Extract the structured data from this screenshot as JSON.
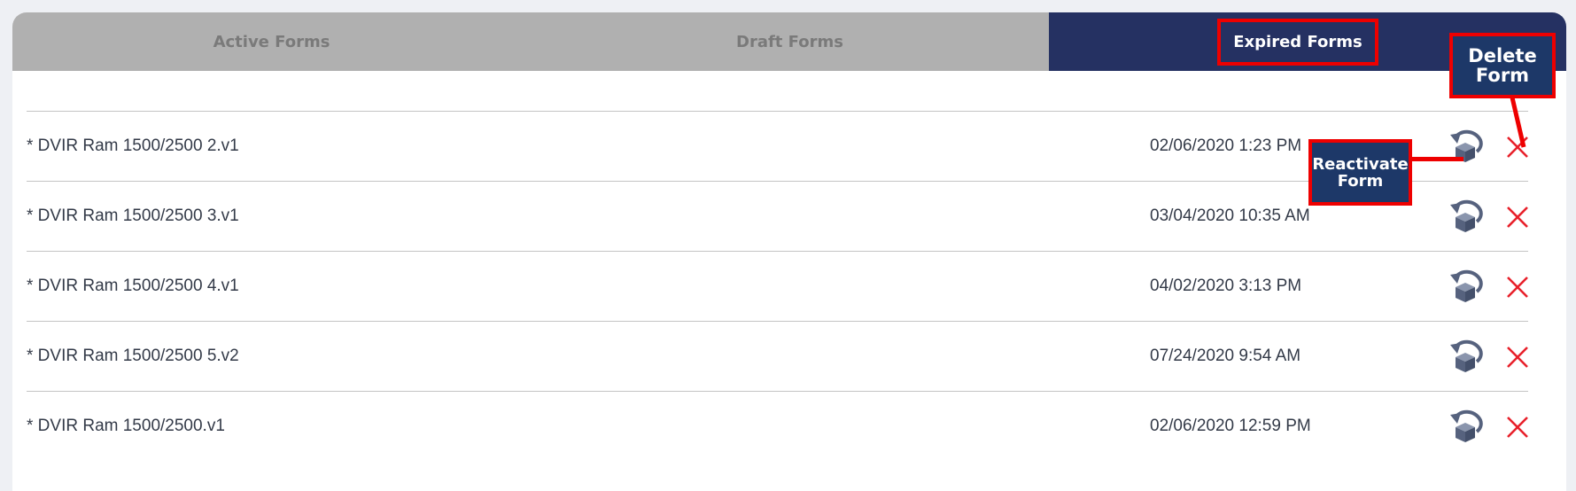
{
  "tabs": [
    {
      "label": "Active Forms",
      "state": "inactive"
    },
    {
      "label": "Draft Forms",
      "state": "inactive"
    },
    {
      "label": "Expired Forms",
      "state": "active"
    }
  ],
  "forms": [
    {
      "name": "* DVIR Ram 1500/2500 2.v1",
      "date": "02/06/2020 1:23 PM"
    },
    {
      "name": "* DVIR Ram 1500/2500 3.v1",
      "date": "03/04/2020 10:35 AM"
    },
    {
      "name": "* DVIR Ram 1500/2500 4.v1",
      "date": "04/02/2020 3:13 PM"
    },
    {
      "name": "* DVIR Ram 1500/2500 5.v2",
      "date": "07/24/2020 9:54 AM"
    },
    {
      "name": "* DVIR Ram 1500/2500.v1",
      "date": "02/06/2020 12:59 PM"
    }
  ],
  "icons": {
    "reactivate": "reactivate-box-icon",
    "delete": "close-x-icon"
  },
  "annotations": {
    "reactivate": {
      "line1": "Reactivate",
      "line2": "Form"
    },
    "delete": {
      "line1": "Delete",
      "line2": "Form"
    }
  },
  "colors": {
    "active_tab": "#253162",
    "inactive_tab": "#b0b0b0",
    "delete_x": "#e8202a",
    "reactivate_icon": "#56627e",
    "annotation_border": "#ee0000",
    "annotation_bg": "#1d3868"
  }
}
